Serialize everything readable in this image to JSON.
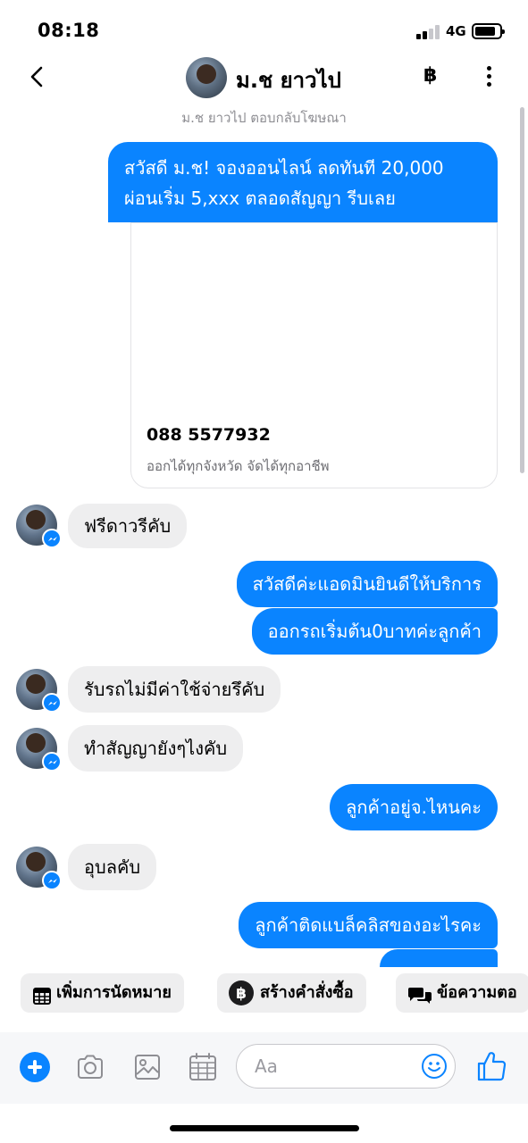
{
  "status_bar": {
    "time": "08:18",
    "network": "4G"
  },
  "header": {
    "name": "ม.ช ยาวไป",
    "baht_symbol": "฿",
    "subtitle": "ม.ช ยาวไป ตอบกลับโฆษณา"
  },
  "ad": {
    "message_line1": "สวัสดี ม.ช! จองออนไลน์ ลดทันที 20,000",
    "message_line2": "ผ่อนเริ่ม 5,xxx ตลอดสัญญา รีบเลย",
    "phone": "088 5577932",
    "description": "ออกได้ทุกจังหวัด จัดได้ทุกอาชีพ"
  },
  "messages": [
    {
      "from": "customer",
      "text": "ฟรีดาวรีคับ"
    },
    {
      "from": "page",
      "text": "สวัสดีค่ะแอดมินยินดีให้บริการ"
    },
    {
      "from": "page",
      "text": "ออกรถเริ่มต้น0บาทค่ะลูกค้า"
    },
    {
      "from": "customer",
      "text": "รับรถไม่มีค่าใช้จ่ายรึคับ"
    },
    {
      "from": "customer",
      "text": "ทำสัญญายังๆไงคับ"
    },
    {
      "from": "page",
      "text": "ลูกค้าอยู่จ.ไหนคะ"
    },
    {
      "from": "customer",
      "text": "อุบลคับ"
    },
    {
      "from": "page",
      "text": "ลูกค้าติดแบล็คลิสของอะไรคะ"
    }
  ],
  "quick_replies": [
    {
      "label": "เพิ่มการนัดหมาย",
      "icon": "calendar-icon"
    },
    {
      "label": "สร้างคำสั่งซื้อ",
      "icon": "baht-icon"
    },
    {
      "label": "ข้อความตอ",
      "icon": "chat-bubbles-icon"
    }
  ],
  "composer": {
    "placeholder": "Aa"
  },
  "colors": {
    "accent": "#0a84ff",
    "incoming_bubble": "#eeeeef",
    "chip": "#eeeeef"
  }
}
